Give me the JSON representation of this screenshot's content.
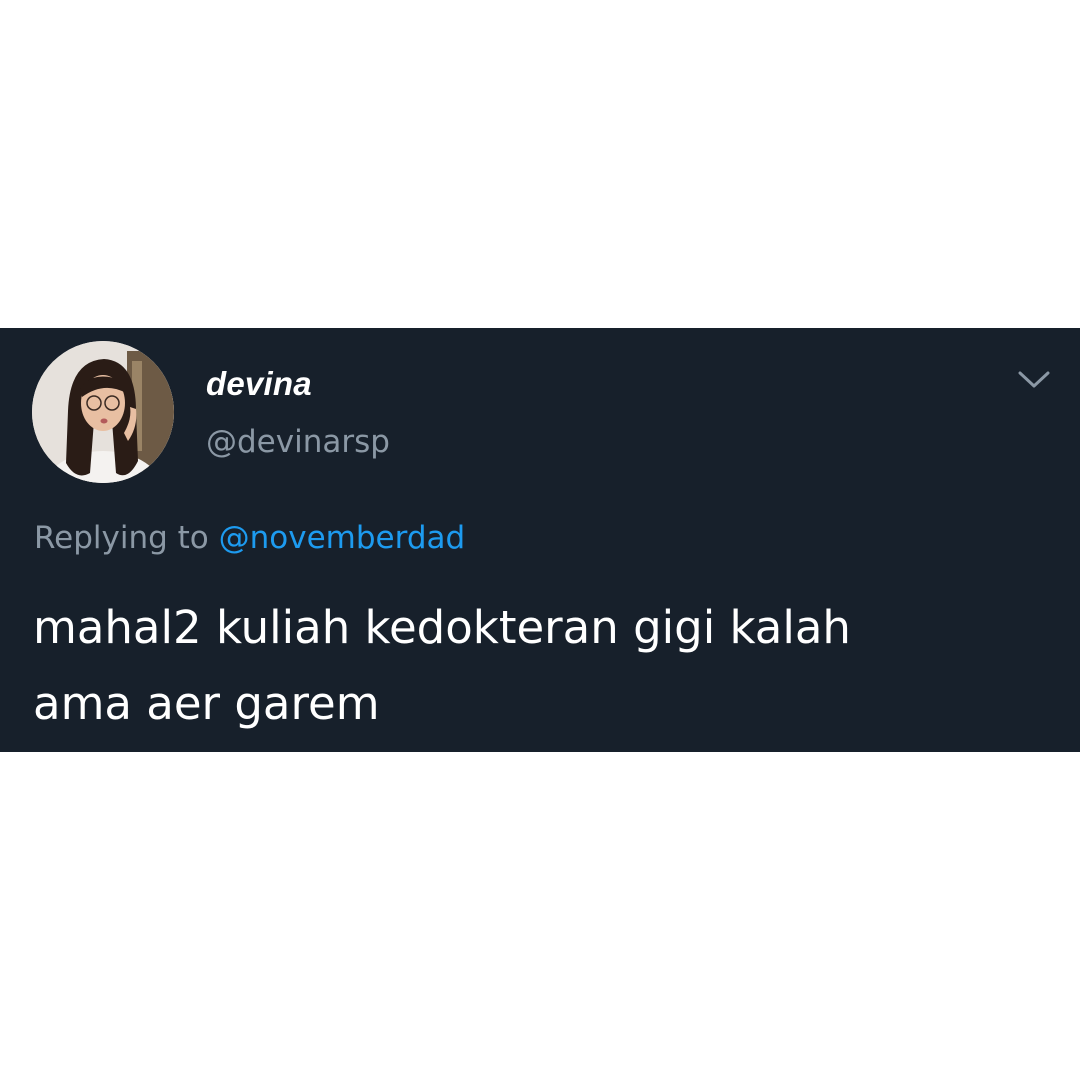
{
  "tweet": {
    "display_name": "devina",
    "handle": "@devinarsp",
    "replying_prefix": "Replying to",
    "replying_to": "@novemberdad",
    "text_lines": [
      "mahal2 kuliah kedokteran gigi kalah",
      "ama aer garem"
    ]
  },
  "icons": {
    "avatar": "profile-photo",
    "menu": "chevron-down-icon"
  },
  "colors": {
    "card_background": "#17202b",
    "page_background": "#ffffff",
    "primary_text": "#ffffff",
    "secondary_text": "#8b98a5",
    "link": "#1d9bf0"
  }
}
